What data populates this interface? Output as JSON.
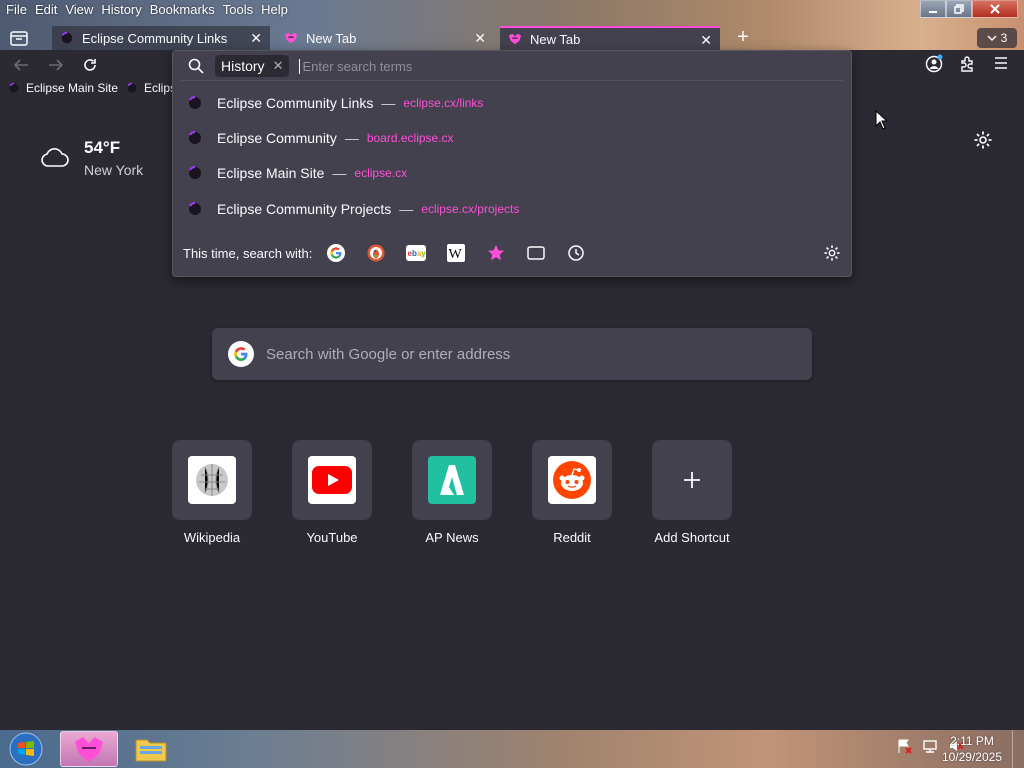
{
  "menubar": {
    "items": [
      "File",
      "Edit",
      "View",
      "History",
      "Bookmarks",
      "Tools",
      "Help"
    ]
  },
  "tabs": [
    {
      "title": "Eclipse Community Links",
      "favicon": "eclipse-favicon"
    },
    {
      "title": "New Tab",
      "favicon": "browser-favicon"
    },
    {
      "title": "New Tab",
      "favicon": "browser-favicon"
    }
  ],
  "tab_count": "3",
  "bookmarks": [
    {
      "label": "Eclipse Main Site"
    },
    {
      "label": "Eclips"
    }
  ],
  "urlbar": {
    "chip_label": "History",
    "placeholder": "Enter search terms"
  },
  "results": [
    {
      "title": "Eclipse Community Links",
      "url": "eclipse.cx/links"
    },
    {
      "title": "Eclipse Community",
      "url": "board.eclipse.cx"
    },
    {
      "title": "Eclipse Main Site",
      "url": "eclipse.cx"
    },
    {
      "title": "Eclipse Community Projects",
      "url": "eclipse.cx/projects"
    }
  ],
  "result_separator": "—",
  "search_with": {
    "label": "This time, search with:",
    "engines": [
      "google-icon",
      "duckduckgo-icon",
      "ebay-icon",
      "wikipedia-icon",
      "bookmarks-star-icon",
      "tabs-icon",
      "history-clock-icon"
    ]
  },
  "weather": {
    "temp": "54°F",
    "city": "New York",
    "icon": "cloud-icon"
  },
  "search": {
    "placeholder": "Search with Google or enter address"
  },
  "shortcuts": [
    {
      "label": "Wikipedia",
      "icon": "wikipedia-icon"
    },
    {
      "label": "YouTube",
      "icon": "youtube-icon"
    },
    {
      "label": "AP News",
      "icon": "apnews-icon"
    },
    {
      "label": "Reddit",
      "icon": "reddit-icon"
    },
    {
      "label": "Add Shortcut",
      "icon": "plus-icon"
    }
  ],
  "taskbar": {
    "time": "2:11 PM",
    "date": "10/29/2025"
  },
  "colors": {
    "accent": "#ff4fd8",
    "panel": "#42414d",
    "background": "#2b2a33"
  }
}
